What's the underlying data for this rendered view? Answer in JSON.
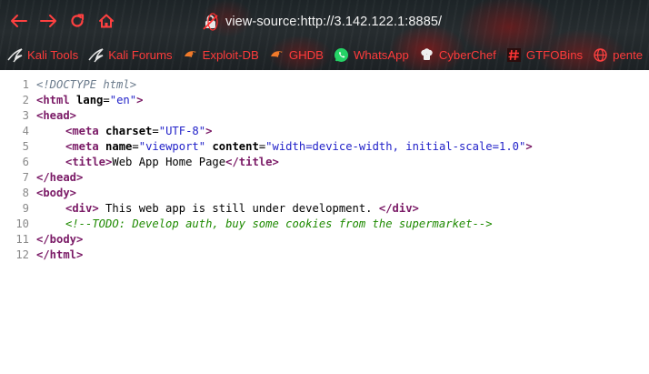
{
  "browser": {
    "url": "view-source:http://3.142.122.1:8885/",
    "bookmarks": [
      {
        "label": "Kali Tools",
        "icon": "kali-dragon-icon"
      },
      {
        "label": "Kali Forums",
        "icon": "kali-dragon-icon"
      },
      {
        "label": "Exploit-DB",
        "icon": "exploit-db-icon"
      },
      {
        "label": "GHDB",
        "icon": "ghdb-icon"
      },
      {
        "label": "WhatsApp",
        "icon": "whatsapp-icon"
      },
      {
        "label": "CyberChef",
        "icon": "cyberchef-icon"
      },
      {
        "label": "GTFOBins",
        "icon": "gtfobins-icon"
      },
      {
        "label": "pente",
        "icon": "globe-icon"
      }
    ],
    "bookmark_color": "#ff3b3b"
  },
  "source": {
    "line_numbers": [
      "1",
      "2",
      "3",
      "4",
      "5",
      "6",
      "7",
      "8",
      "9",
      "10",
      "11",
      "12"
    ],
    "doctype": "<!DOCTYPE html>",
    "html_open": "<html",
    "lang_attr": "lang",
    "lang_val": "\"en\"",
    "gt": ">",
    "head_open": "<head>",
    "meta": "<meta",
    "charset_attr": "charset",
    "charset_val": "\"UTF-8\"",
    "name_attr": "name",
    "name_val": "\"viewport\"",
    "content_attr": "content",
    "content_val": "\"width=device-width, initial-scale=1.0\"",
    "title_open": "<title>",
    "title_text": "Web App Home Page",
    "title_close": "</title>",
    "head_close": "</head>",
    "body_open": "<body>",
    "div_open": "<div>",
    "div_text": " This web app is still under development. ",
    "div_close": "</div>",
    "comment": "<!--TODO: Develop auth, buy some cookies from the supermarket-->",
    "body_close": "</body>",
    "html_close": "</html>"
  }
}
